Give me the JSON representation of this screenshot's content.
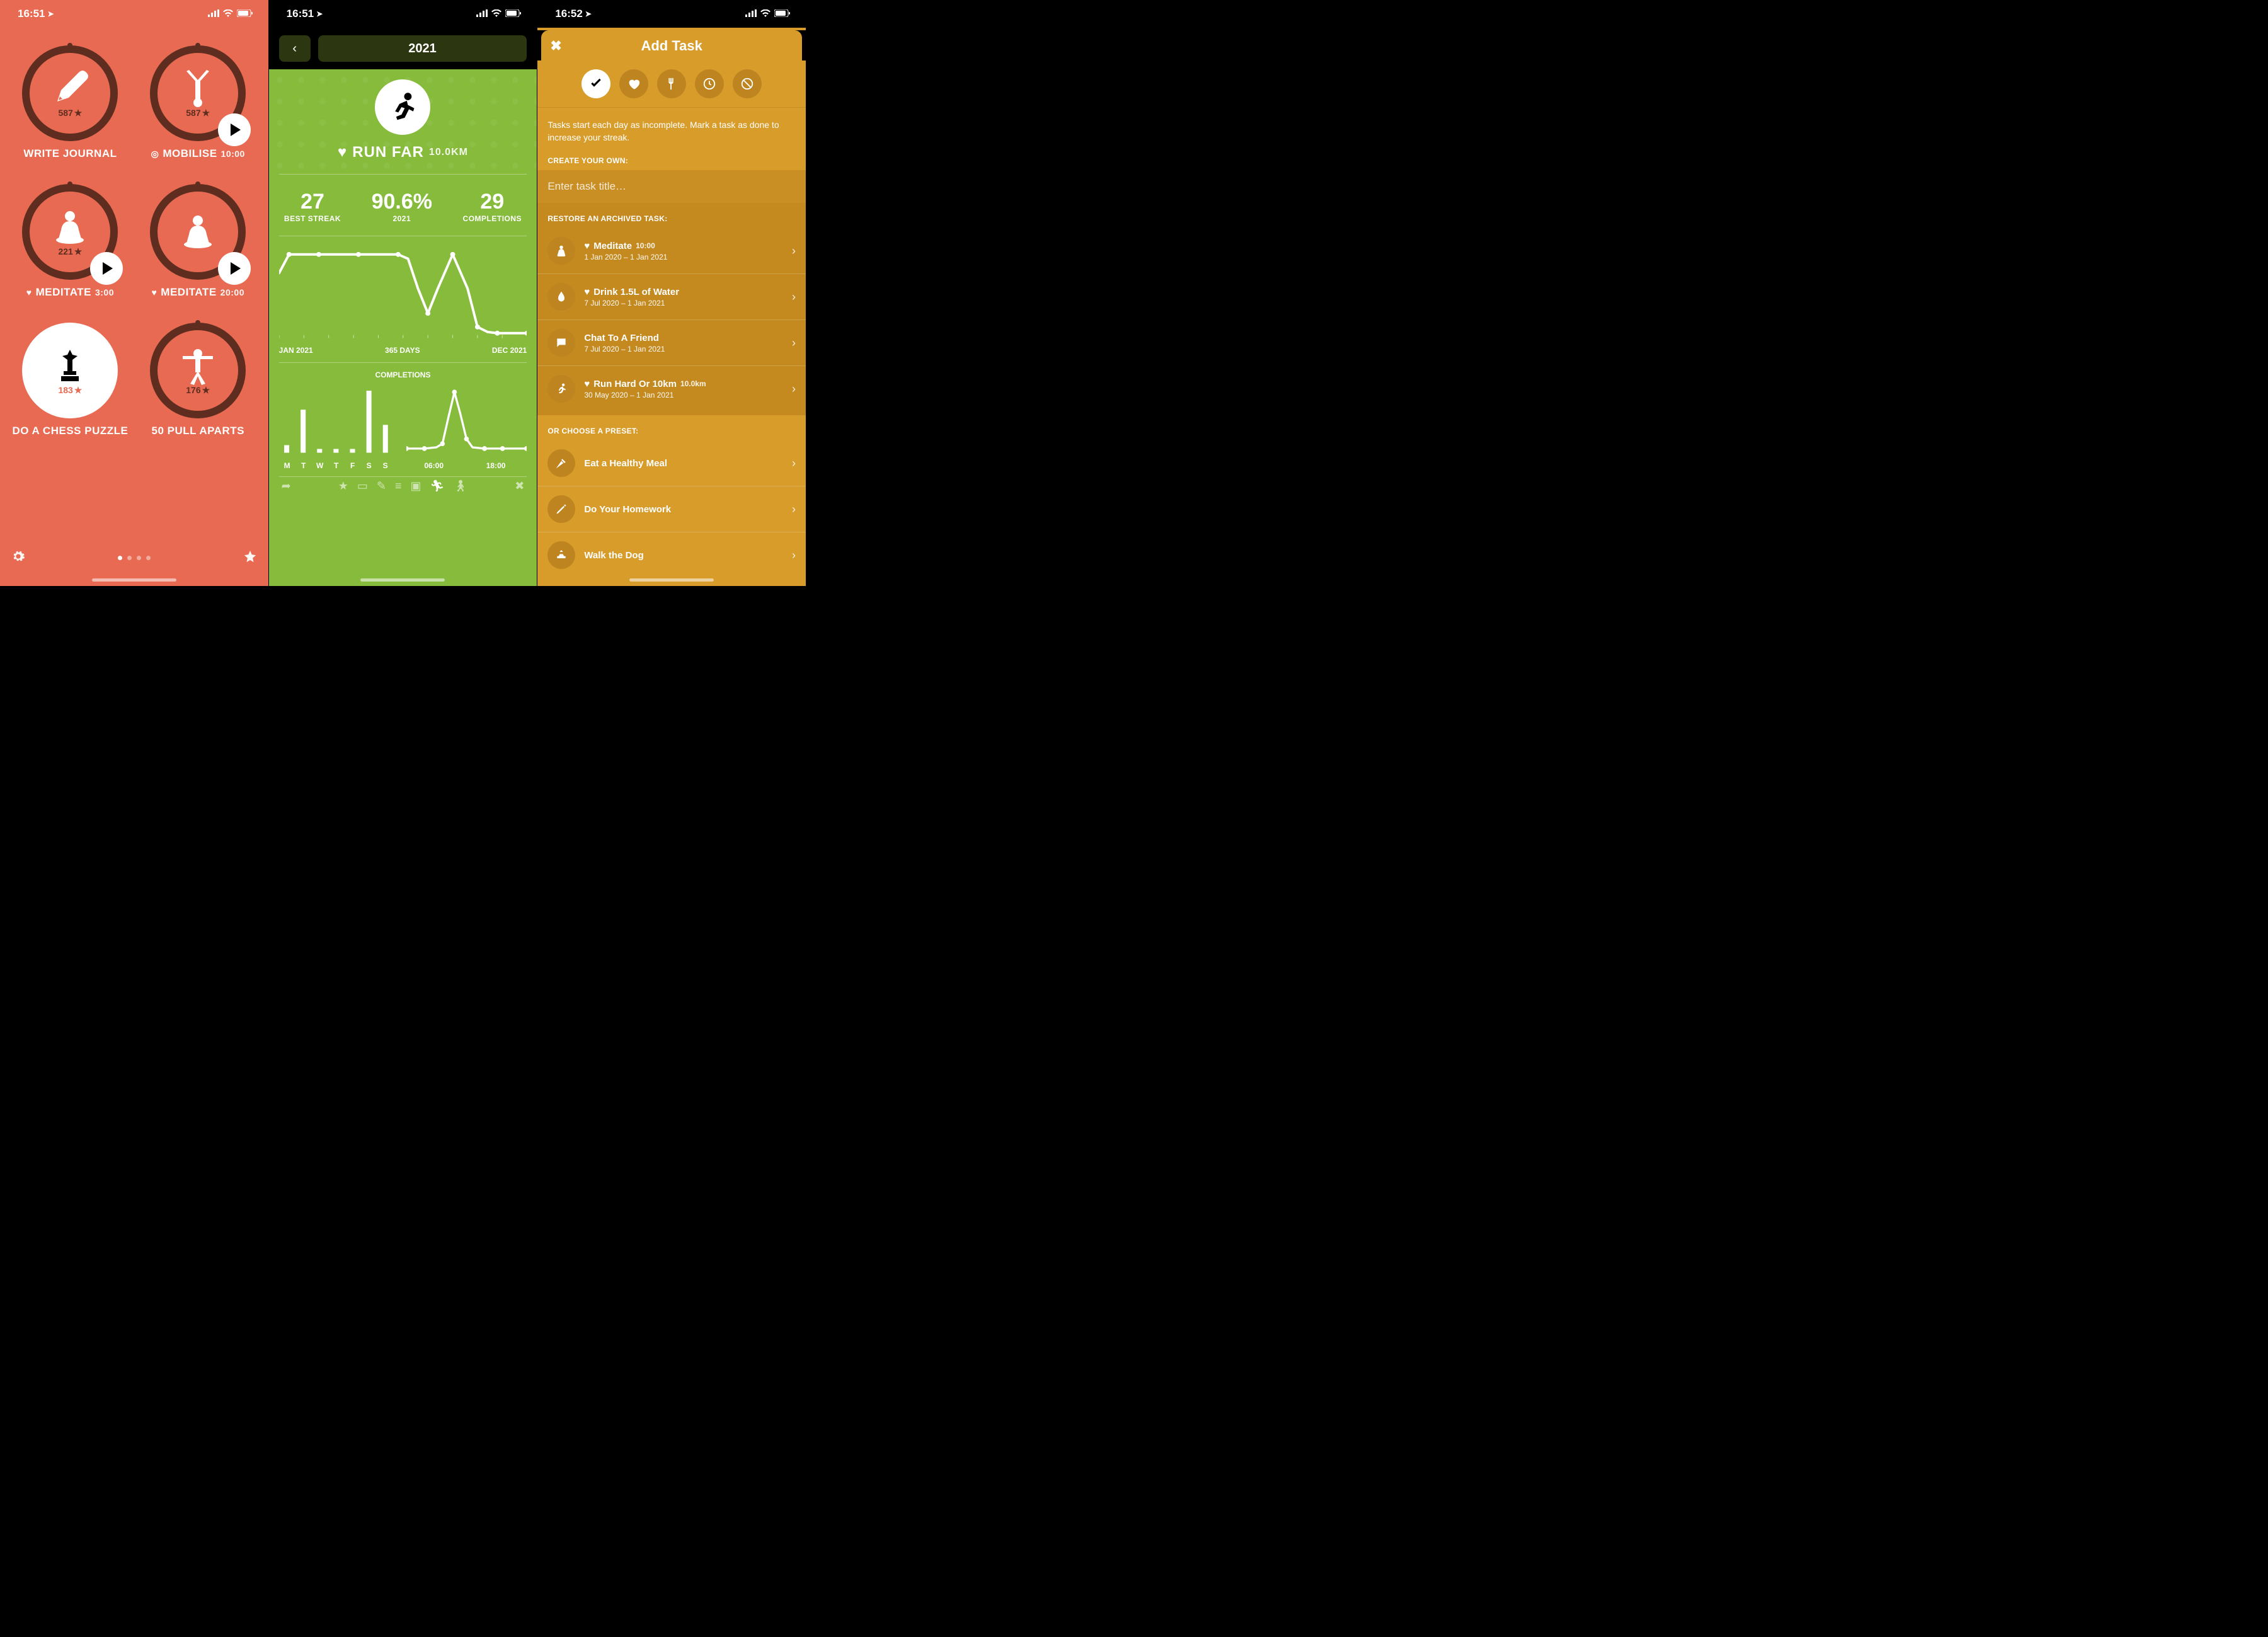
{
  "screen1": {
    "status_time": "16:51",
    "tasks": [
      {
        "label": "WRITE JOURNAL",
        "streak": "587",
        "timer": "",
        "prefix": ""
      },
      {
        "label": "MOBILISE",
        "streak": "587",
        "timer": "10:00",
        "prefix": "◎"
      },
      {
        "label": "MEDITATE",
        "streak": "221",
        "timer": "3:00",
        "prefix": "♥"
      },
      {
        "label": "MEDITATE",
        "streak": "",
        "timer": "20:00",
        "prefix": "♥"
      },
      {
        "label": "DO A CHESS PUZZLE",
        "streak": "183",
        "timer": "",
        "prefix": ""
      },
      {
        "label": "50 PULL APARTS",
        "streak": "176",
        "timer": "",
        "prefix": ""
      }
    ]
  },
  "screen2": {
    "status_time": "16:51",
    "year": "2021",
    "task_name": "RUN FAR",
    "task_dist": "10.0KM",
    "best_streak": "27",
    "best_streak_label": "BEST STREAK",
    "pct": "90.6%",
    "pct_label": "2021",
    "completions": "29",
    "completions_label": "COMPLETIONS",
    "range_start": "JAN 2021",
    "range_mid": "365 DAYS",
    "range_end": "DEC 2021",
    "comp_title": "COMPLETIONS",
    "days": [
      "M",
      "T",
      "W",
      "T",
      "F",
      "S",
      "S"
    ],
    "times": [
      "06:00",
      "18:00"
    ]
  },
  "screen3": {
    "status_time": "16:52",
    "title": "Add Task",
    "desc": "Tasks start each day as incomplete. Mark a task as done to increase your streak.",
    "create_label": "CREATE YOUR OWN:",
    "placeholder": "Enter task title…",
    "restore_label": "RESTORE AN ARCHIVED TASK:",
    "archived": [
      {
        "title": "Meditate",
        "extra": "10:00",
        "range": "1 Jan 2020 – 1 Jan 2021",
        "heart": true
      },
      {
        "title": "Drink 1.5L of Water",
        "extra": "",
        "range": "7 Jul 2020 – 1 Jan 2021",
        "heart": true
      },
      {
        "title": "Chat To A Friend",
        "extra": "",
        "range": "7 Jul 2020 – 1 Jan 2021",
        "heart": false
      },
      {
        "title": "Run Hard Or 10km",
        "extra": "10.0km",
        "range": "30 May 2020 – 1 Jan 2021",
        "heart": true
      }
    ],
    "preset_label": "OR CHOOSE A PRESET:",
    "presets": [
      {
        "title": "Eat a Healthy Meal"
      },
      {
        "title": "Do Your Homework"
      },
      {
        "title": "Walk the Dog"
      }
    ]
  },
  "chart_data": [
    {
      "type": "line",
      "title": "",
      "xlabel": "",
      "ylabel": "",
      "x_range_labels": [
        "JAN 2021",
        "365 DAYS",
        "DEC 2021"
      ],
      "ylim": [
        0,
        100
      ],
      "x": [
        0,
        0.04,
        0.08,
        0.16,
        0.24,
        0.32,
        0.4,
        0.48,
        0.52,
        0.56,
        0.6,
        0.64,
        0.7,
        0.76,
        0.8,
        0.84,
        0.88,
        0.92,
        0.96,
        1.0
      ],
      "values": [
        80,
        95,
        95,
        95,
        95,
        95,
        95,
        95,
        90,
        60,
        30,
        60,
        95,
        60,
        15,
        8,
        6,
        5,
        5,
        5
      ],
      "note": "Percentage-style trend over 2021 — plateau, dip mid-year, spike, then collapse to baseline"
    },
    {
      "type": "bar",
      "title": "COMPLETIONS",
      "subtitle_left": "by weekday",
      "categories": [
        "M",
        "T",
        "W",
        "T",
        "F",
        "S",
        "S"
      ],
      "values": [
        2,
        9,
        1,
        1,
        1,
        13,
        6
      ],
      "ylim": [
        0,
        15
      ]
    },
    {
      "type": "line",
      "title": "COMPLETIONS",
      "subtitle_right": "by time of day",
      "x_labels": [
        "06:00",
        "18:00"
      ],
      "x": [
        0,
        4,
        6,
        7,
        8,
        9,
        10,
        11,
        12,
        16,
        20,
        24
      ],
      "values": [
        1,
        1,
        1,
        2,
        9,
        14,
        8,
        3,
        1,
        1,
        1,
        1
      ],
      "ylim": [
        0,
        15
      ]
    }
  ]
}
